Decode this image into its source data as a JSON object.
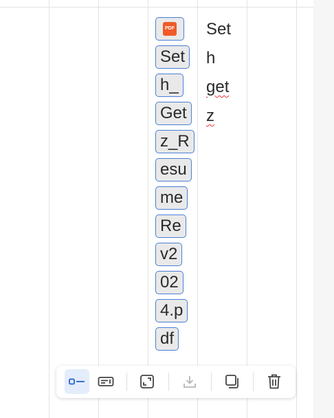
{
  "chips": [
    {
      "label": "",
      "icon": "pdf-file-icon",
      "icon_text": "PDF"
    },
    {
      "label": "Set"
    },
    {
      "label": "h_"
    },
    {
      "label": "Get"
    },
    {
      "label": "z_R"
    },
    {
      "label": "esu"
    },
    {
      "label": "me"
    },
    {
      "label": "Re"
    },
    {
      "label": "v2"
    },
    {
      "label": "02"
    },
    {
      "label": "4.p"
    },
    {
      "label": "df"
    }
  ],
  "words": [
    {
      "text": "Set",
      "misspelled": false
    },
    {
      "text": "h",
      "misspelled": false
    },
    {
      "text": "get",
      "misspelled": true
    },
    {
      "text": "z",
      "misspelled": true
    }
  ],
  "toolbar": {
    "buttons": [
      {
        "icon": "inline-view-icon",
        "active": true
      },
      {
        "icon": "card-view-icon",
        "active": false
      },
      {
        "icon": "expand-icon",
        "active": false
      },
      {
        "icon": "download-icon",
        "active": false,
        "disabled": true
      },
      {
        "icon": "duplicate-icon",
        "active": false
      },
      {
        "icon": "delete-icon",
        "active": false
      }
    ]
  },
  "colors": {
    "chip_border": "#4a7fd6",
    "pdf_icon": "#f05a28",
    "active_button_bg": "#e4edfb",
    "spellcheck_underline": "#e33"
  }
}
